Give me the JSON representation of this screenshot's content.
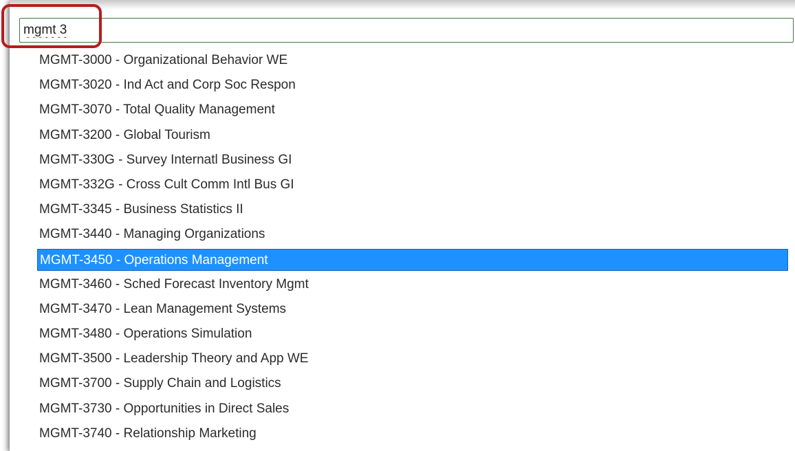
{
  "search": {
    "value": "mgmt 3"
  },
  "results": [
    {
      "label": "MGMT-3000 - Organizational Behavior WE",
      "selected": false
    },
    {
      "label": "MGMT-3020 - Ind Act and Corp Soc Respon",
      "selected": false
    },
    {
      "label": "MGMT-3070 - Total Quality Management",
      "selected": false
    },
    {
      "label": "MGMT-3200 - Global Tourism",
      "selected": false
    },
    {
      "label": "MGMT-330G - Survey Internatl Business GI",
      "selected": false
    },
    {
      "label": "MGMT-332G - Cross Cult Comm Intl Bus GI",
      "selected": false
    },
    {
      "label": "MGMT-3345 - Business Statistics II",
      "selected": false
    },
    {
      "label": "MGMT-3440 - Managing Organizations",
      "selected": false
    },
    {
      "label": "MGMT-3450 - Operations Management",
      "selected": true
    },
    {
      "label": "MGMT-3460 - Sched Forecast Inventory Mgmt",
      "selected": false
    },
    {
      "label": "MGMT-3470 - Lean Management Systems",
      "selected": false
    },
    {
      "label": "MGMT-3480 - Operations Simulation",
      "selected": false
    },
    {
      "label": "MGMT-3500 - Leadership Theory and App WE",
      "selected": false
    },
    {
      "label": "MGMT-3700 - Supply Chain and Logistics",
      "selected": false
    },
    {
      "label": "MGMT-3730 - Opportunities in Direct Sales",
      "selected": false
    },
    {
      "label": "MGMT-3740 - Relationship Marketing",
      "selected": false
    }
  ],
  "colors": {
    "selection": "#1e90ff",
    "input_border": "#3c7a3c",
    "highlight_annotation": "#b71c1c"
  }
}
